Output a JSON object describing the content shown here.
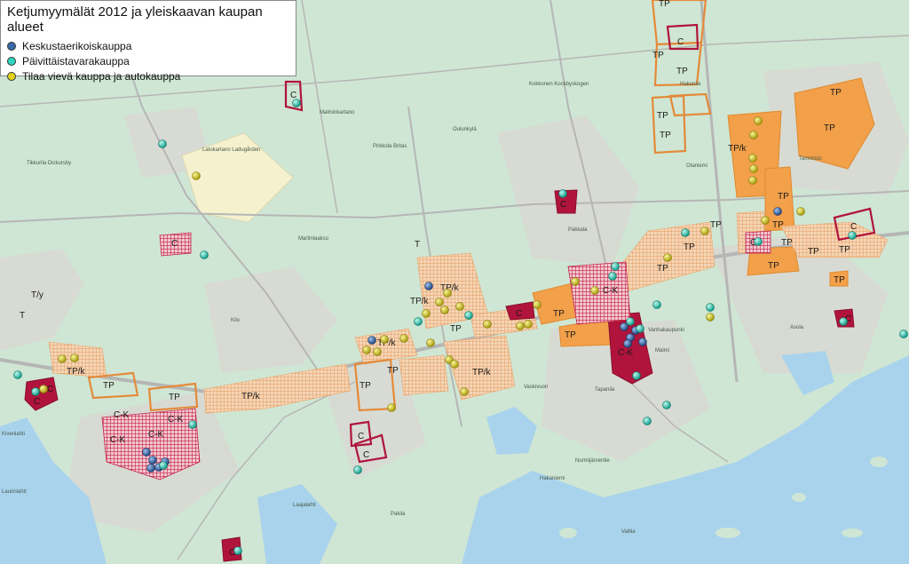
{
  "legend": {
    "title": "Ketjumyymälät 2012 ja yleiskaavan kaupan alueet",
    "items": [
      {
        "label": "Keskustaerikoiskauppa",
        "color": "#3a6aa8"
      },
      {
        "label": "Päivittäistavarakauppa",
        "color": "#2fd6c0"
      },
      {
        "label": "Tilaa vievä kauppa ja autokauppa",
        "color": "#e2d21c"
      }
    ]
  },
  "colors": {
    "land": "#cfe6d4",
    "water": "#a9d3ec",
    "urban": "#d7d6d0",
    "center_zone": "#b0143c",
    "tp_zone": "#f2a04a",
    "tp_hatch": "#e9a46b",
    "road": "#b8b8b8"
  },
  "zones": {
    "c": "C",
    "ck": "C-K",
    "tp": "TP",
    "tpk": "TP/k",
    "t": "T",
    "ty": "T/y"
  },
  "places": [
    "Tikkurila Dickursby",
    "Latokartano Ladugården",
    "Malminkartano",
    "Pirkkola Britas",
    "Oulunkylä",
    "Kokkonen Kockbyskogen",
    "Martinlaakso",
    "Pakkala",
    "Hakunila",
    "Tammisto",
    "Otaniemi",
    "Kilo",
    "Vanhakaupunki",
    "Asola",
    "Malmi",
    "Vaskivuori",
    "Nurmijärventie",
    "Laurinlahti",
    "Hakaniemi",
    "Tapanila",
    "Pakila",
    "Laajalahti",
    "Kivenlahti",
    "Vallila"
  ]
}
